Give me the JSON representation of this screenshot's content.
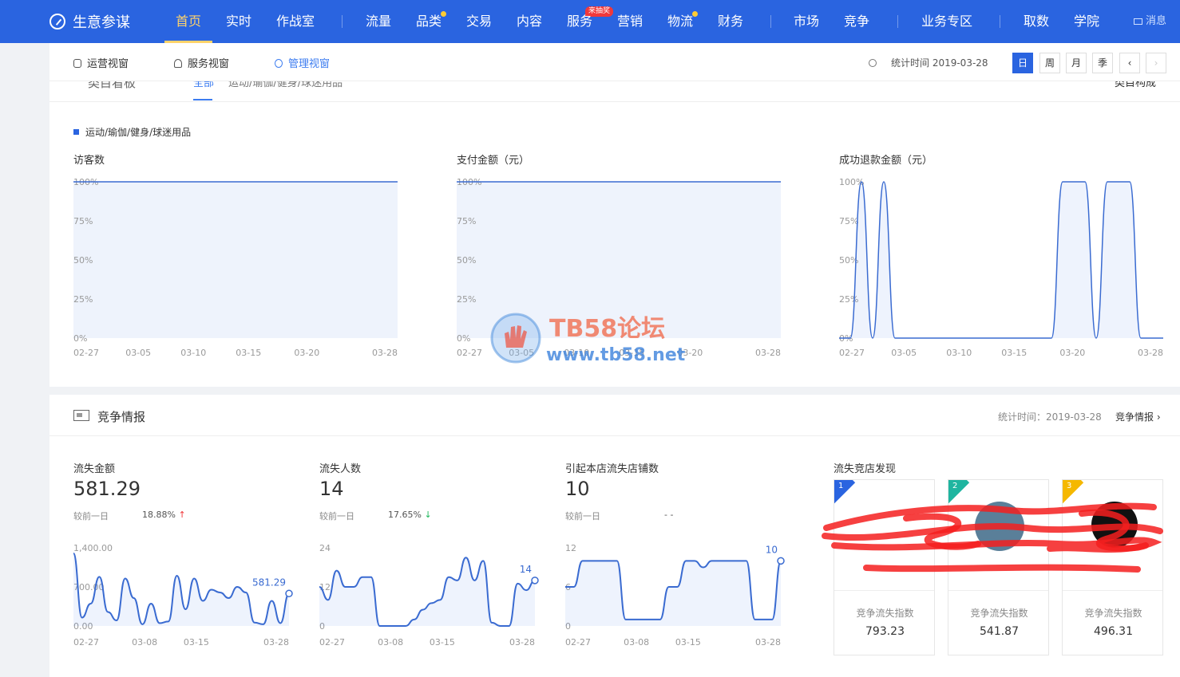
{
  "brand": {
    "name": "生意参谋"
  },
  "nav": {
    "items": [
      {
        "label": "首页",
        "active": true
      },
      {
        "label": "实时"
      },
      {
        "label": "作战室"
      },
      {
        "label": "流量"
      },
      {
        "label": "品类",
        "dot": true
      },
      {
        "label": "交易"
      },
      {
        "label": "内容"
      },
      {
        "label": "服务",
        "badge": "来抽奖"
      },
      {
        "label": "营销"
      },
      {
        "label": "物流",
        "dot": true
      },
      {
        "label": "财务"
      },
      {
        "label": "市场"
      },
      {
        "label": "竞争"
      },
      {
        "label": "业务专区"
      },
      {
        "label": "取数"
      },
      {
        "label": "学院"
      }
    ],
    "message": "消息"
  },
  "subnav": {
    "tabs": [
      "运营视窗",
      "服务视窗",
      "管理视窗"
    ],
    "active_tab": "管理视窗",
    "stat_time": "统计时间 2019-03-28",
    "periods": [
      "日",
      "周",
      "月",
      "季"
    ],
    "active_period": "日"
  },
  "category_board": {
    "header_fragments": [
      "类目看板",
      "全部",
      "运动/瑜伽/健身/球迷用品",
      "类目构成"
    ],
    "legend": "运动/瑜伽/健身/球迷用品",
    "charts": [
      {
        "title": "访客数",
        "chart_data": {
          "type": "area",
          "x_ticks": [
            "02-27",
            "03-05",
            "03-10",
            "03-15",
            "03-20",
            "03-28"
          ],
          "y_ticks": [
            "100%",
            "75%",
            "50%",
            "25%",
            "0%"
          ],
          "ylim": [
            0,
            100
          ],
          "values": [
            100,
            100,
            100,
            100,
            100,
            100,
            100,
            100,
            100,
            100,
            100,
            100,
            100,
            100,
            100,
            100,
            100,
            100,
            100,
            100,
            100,
            100,
            100,
            100,
            100,
            100,
            100,
            100,
            100,
            100
          ]
        }
      },
      {
        "title": "支付金额（元）",
        "chart_data": {
          "type": "area",
          "x_ticks": [
            "02-27",
            "03-05",
            "03-10",
            "03-15",
            "03-20",
            "03-28"
          ],
          "y_ticks": [
            "100%",
            "75%",
            "50%",
            "25%",
            "0%"
          ],
          "ylim": [
            0,
            100
          ],
          "values": [
            100,
            100,
            100,
            100,
            100,
            100,
            100,
            100,
            100,
            100,
            100,
            100,
            100,
            100,
            100,
            100,
            100,
            100,
            100,
            100,
            100,
            100,
            100,
            100,
            100,
            100,
            100,
            100,
            100,
            100
          ]
        }
      },
      {
        "title": "成功退款金额（元）",
        "chart_data": {
          "type": "area",
          "x_ticks": [
            "02-27",
            "03-05",
            "03-10",
            "03-15",
            "03-20",
            "03-28"
          ],
          "y_ticks": [
            "100%",
            "75%",
            "50%",
            "25%",
            "0%"
          ],
          "ylim": [
            0,
            100
          ],
          "values": [
            0,
            0,
            100,
            0,
            100,
            0,
            0,
            0,
            0,
            0,
            0,
            0,
            0,
            0,
            0,
            0,
            0,
            0,
            0,
            0,
            100,
            100,
            100,
            0,
            100,
            100,
            100,
            0,
            0,
            0
          ]
        }
      }
    ]
  },
  "competition": {
    "title": "竞争情报",
    "stat_time": "统计时间：2019-03-28",
    "link": "竞争情报",
    "metrics": [
      {
        "label": "流失金额",
        "value": "581.29",
        "compare_label": "较前一日",
        "compare_value": "18.88%",
        "trend": "up",
        "chart_data": {
          "type": "area",
          "x_ticks": [
            "02-27",
            "03-08",
            "03-15",
            "03-28"
          ],
          "y_ticks": [
            "1,400.00",
            "700.00",
            "0.00"
          ],
          "ylim": [
            0,
            1400
          ],
          "values": [
            1300,
            150,
            400,
            880,
            250,
            100,
            850,
            500,
            30,
            400,
            50,
            80,
            900,
            300,
            850,
            450,
            650,
            600,
            500,
            700,
            600,
            60,
            30,
            450,
            50,
            581.29
          ],
          "last_label": "581.29"
        }
      },
      {
        "label": "流失人数",
        "value": "14",
        "compare_label": "较前一日",
        "compare_value": "17.65%",
        "trend": "down",
        "chart_data": {
          "type": "area",
          "x_ticks": [
            "02-27",
            "03-08",
            "03-15",
            "03-28"
          ],
          "y_ticks": [
            "24",
            "12",
            "0"
          ],
          "ylim": [
            0,
            24
          ],
          "values": [
            12,
            8,
            17,
            12,
            12,
            15,
            15,
            0,
            0,
            0,
            0,
            2,
            5,
            7,
            8,
            15,
            14,
            21,
            14,
            20,
            1,
            0,
            0,
            13,
            11,
            14
          ],
          "last_label": "14"
        }
      },
      {
        "label": "引起本店流失店铺数",
        "value": "10",
        "compare_label": "较前一日",
        "compare_value": "- -",
        "chart_data": {
          "type": "area",
          "x_ticks": [
            "02-27",
            "03-08",
            "03-15",
            "03-28"
          ],
          "y_ticks": [
            "12",
            "6",
            "0"
          ],
          "ylim": [
            0,
            12
          ],
          "values": [
            6,
            6,
            10,
            10,
            10,
            10,
            10,
            1,
            1,
            1,
            1,
            1,
            6,
            6,
            10,
            10,
            9,
            10,
            10,
            10,
            10,
            10,
            1,
            1,
            1,
            10
          ],
          "last_label": "10"
        }
      }
    ],
    "rivals": {
      "title": "流失竞店发现",
      "items": [
        {
          "rank": "1",
          "index_label": "竞争流失指数",
          "index_value": "793.23",
          "ribbon_color": "#2a64e0"
        },
        {
          "rank": "2",
          "index_label": "竞争流失指数",
          "index_value": "541.87",
          "ribbon_color": "#1fb5a0"
        },
        {
          "rank": "3",
          "index_label": "竞争流失指数",
          "index_value": "496.31",
          "ribbon_color": "#f5b800"
        }
      ]
    }
  },
  "watermark": {
    "title": "TB58论坛",
    "url": "www.tb58.net"
  }
}
